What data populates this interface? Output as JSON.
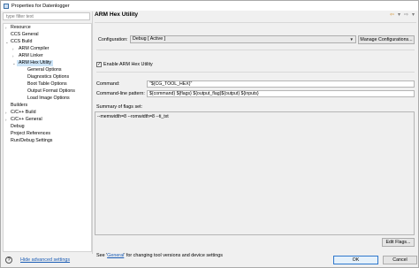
{
  "window": {
    "title": "Properties for Datenlogger"
  },
  "filter": {
    "placeholder": "type filter text"
  },
  "tree": [
    {
      "label": "Resource",
      "twisty": "›"
    },
    {
      "label": "CCS General",
      "twisty": ""
    },
    {
      "label": "CCS Build",
      "twisty": "⌄"
    },
    {
      "label": "ARM Compiler",
      "twisty": "›"
    },
    {
      "label": "ARM Linker",
      "twisty": "›"
    },
    {
      "label": "ARM Hex Utility",
      "twisty": "⌄"
    },
    {
      "label": "General Options",
      "twisty": ""
    },
    {
      "label": "Diagnostics Options",
      "twisty": ""
    },
    {
      "label": "Boot Table Options",
      "twisty": ""
    },
    {
      "label": "Output Format Options",
      "twisty": ""
    },
    {
      "label": "Load Image Options",
      "twisty": ""
    },
    {
      "label": "Builders",
      "twisty": ""
    },
    {
      "label": "C/C++ Build",
      "twisty": "›"
    },
    {
      "label": "C/C++ General",
      "twisty": "›"
    },
    {
      "label": "Debug",
      "twisty": ""
    },
    {
      "label": "Project References",
      "twisty": ""
    },
    {
      "label": "Run/Debug Settings",
      "twisty": ""
    }
  ],
  "page": {
    "title": "ARM Hex Utility",
    "nav": {
      "back": "⇦",
      "forward": "⇨",
      "menu": "▾"
    },
    "configuration_label": "Configuration:",
    "configuration_value": "Debug  [ Active ]",
    "manage_button": "Manage Configurations...",
    "enable_checked": true,
    "enable_label": "Enable ARM Hex Utility",
    "command_label": "Command:",
    "command_value": "\"${CG_TOOL_HEX}\"",
    "pattern_label": "Command-line pattern:",
    "pattern_value": "${command} ${flags} ${output_flag}${output} ${inputs}",
    "summary_label": "Summary of flags set:",
    "summary_value": "--memwidth=8 --romwidth=8 --ti_txt",
    "edit_flags_button": "Edit Flags...",
    "footer_prefix": "See '",
    "footer_link": "General",
    "footer_suffix": "' for changing tool versions and device settings"
  },
  "bottom": {
    "help_icon": "?",
    "advanced_link": "Hide advanced settings",
    "ok_button": "OK",
    "cancel_button": "Cancel"
  }
}
